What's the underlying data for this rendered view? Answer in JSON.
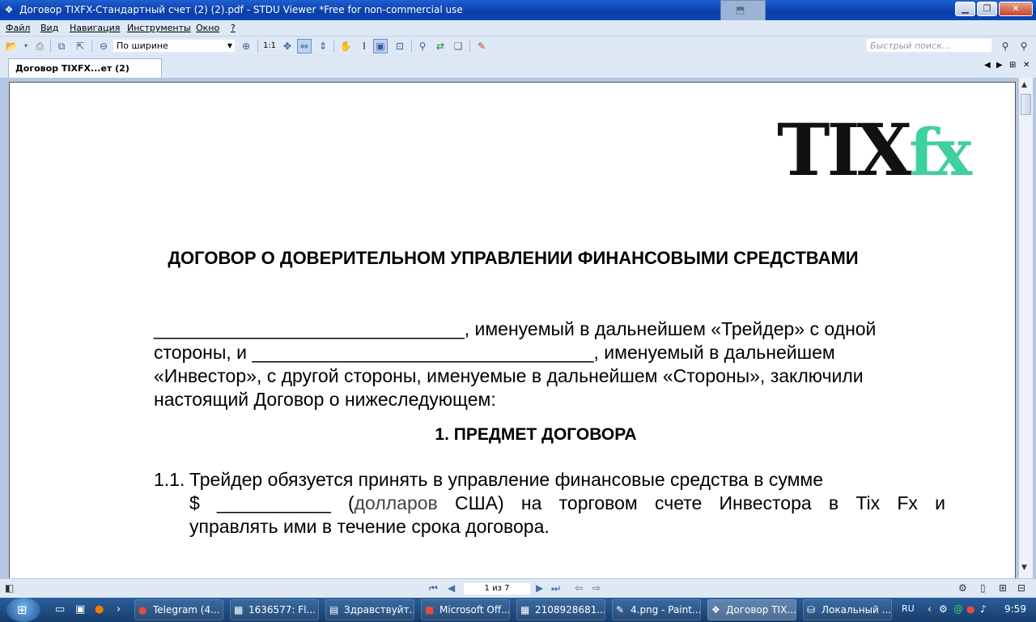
{
  "window": {
    "title": "Договор TIXFX-Стандартный счет (2) (2).pdf - STDU Viewer *Free for non-commercial use",
    "minimize_icon": "minimize-icon",
    "maximize_icon": "maximize-icon",
    "close_icon": "close-icon"
  },
  "menu": {
    "items": [
      "Файл",
      "Вид",
      "Навигация",
      "Инструменты",
      "Окно",
      "?"
    ]
  },
  "toolbar": {
    "zoom_mode": "По ширине",
    "actual_size_label": "1:1",
    "search_placeholder": "Быстрый поиск..."
  },
  "tabs": {
    "active": "Договор TIXFX...ет (2) (2).pdf"
  },
  "document": {
    "logo_part1": "TIX",
    "logo_part2": "fx",
    "logo_color": "#3fcfa0",
    "title": "ДОГОВОР О ДОВЕРИТЕЛЬНОМ УПРАВЛЕНИИ ФИНАНСОВЫМИ СРЕДСТВАМИ",
    "intro_line1": "______________________________, именуемый в дальнейшем «Трейдер» с одной",
    "intro_line2": "стороны, и _________________________________, именуемый в дальнейшем",
    "intro_line3": "«Инвестор», с другой стороны, именуемые в дальнейшем «Стороны», заключили",
    "intro_line4": "настоящий Договор о нижеследующем:",
    "section1_title": "1. ПРЕДМЕТ ДОГОВОРА",
    "item_number": "1.1.",
    "item_line1": "Трейдер обязуется принять в управление финансовые средства в сумме",
    "item_line2a": "$ ___________ (",
    "item_line2b": "долларов",
    "item_line2c": " США) на торговом счете Инвестора в Tix Fx и",
    "item_line3": "управлять ими в течение срока договора."
  },
  "statusbar": {
    "page_info": "1 из 7"
  },
  "taskbar": {
    "tasks": [
      "Telegram (4...",
      "1636577: Fl...",
      "Здравствуйт...",
      "Microsoft Off...",
      "2108928681...",
      "4.png - Paint...",
      "Договор TIX...",
      "Локальный ..."
    ],
    "language": "RU",
    "clock": "9:59"
  }
}
